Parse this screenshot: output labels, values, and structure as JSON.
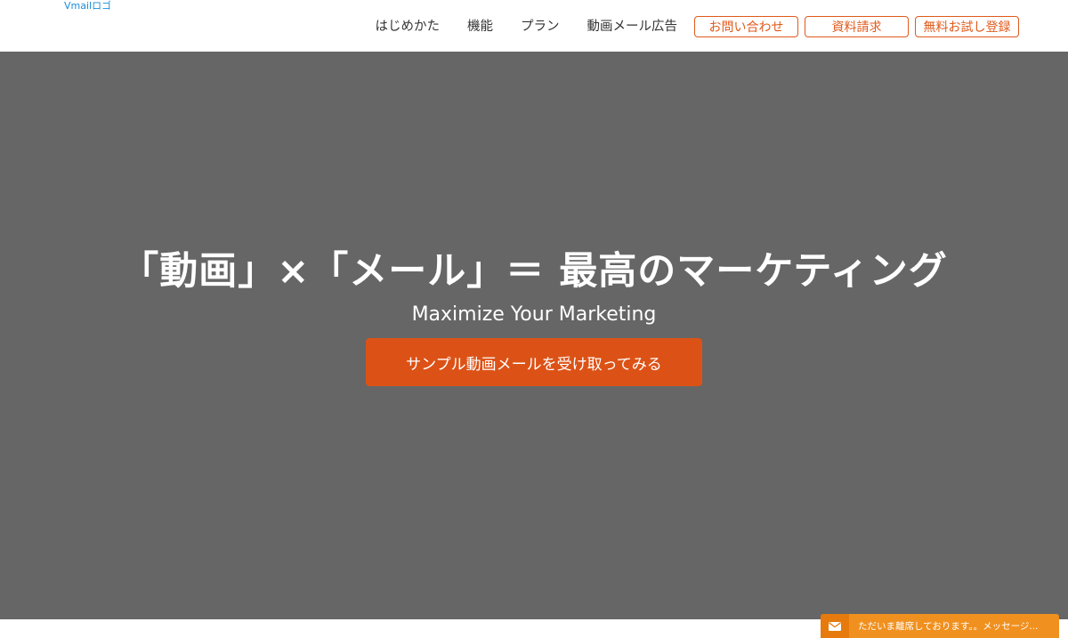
{
  "header": {
    "logo_text": "Vmailロゴ",
    "nav": {
      "links": [
        "はじめかた",
        "機能",
        "プラン",
        "動画メール広告"
      ],
      "buttons": [
        "お問い合わせ",
        "資料請求",
        "無料お試し登録"
      ]
    }
  },
  "hero": {
    "title": "「動画」×「メール」＝ 最高のマーケティング",
    "subtitle": "Maximize Your Marketing",
    "cta_label": "サンプル動画メールを受け取ってみる"
  },
  "chat": {
    "icon": "envelope-icon",
    "text": "ただいま離席しております。。メッセージ..."
  },
  "colors": {
    "accent": "#dc5216",
    "hero_bg": "#666666",
    "chat_bg": "#f0901e",
    "logo": "#1a8fd8"
  }
}
